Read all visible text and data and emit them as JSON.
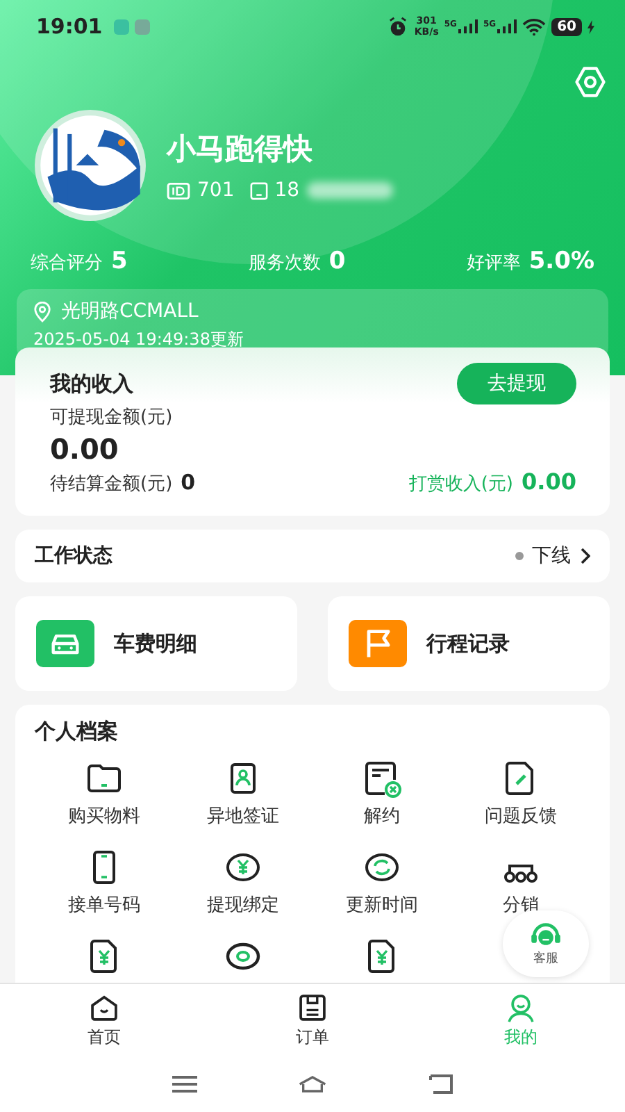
{
  "status_bar": {
    "time": "19:01",
    "speed": "301",
    "speed_unit": "KB/s",
    "network_1": "5G",
    "network_2": "5G",
    "battery": "60"
  },
  "profile": {
    "name": "小马跑得快",
    "id": "701",
    "phone": "18"
  },
  "stats": [
    {
      "label": "综合评分",
      "value": "5"
    },
    {
      "label": "服务次数",
      "value": "0"
    },
    {
      "label": "好评率",
      "value": "5.0%"
    }
  ],
  "location": {
    "place": "光明路CCMALL",
    "updated": "2025-05-04 19:49:38更新"
  },
  "income": {
    "title": "我的收入",
    "withdraw_button": "去提现",
    "available_label": "可提现金额(元)",
    "available_value": "0.00",
    "pending_label": "待结算金额(元)",
    "pending_value": "0",
    "tips_label": "打赏收入(元)",
    "tips_value": "0.00"
  },
  "work_status": {
    "label": "工作状态",
    "status": "下线",
    "online": false
  },
  "shortcuts": [
    {
      "label": "车费明细",
      "color": "#22c065"
    },
    {
      "label": "行程记录",
      "color": "#ff8a00"
    }
  ],
  "archive": {
    "title": "个人档案",
    "items": [
      {
        "kind": "labelled",
        "label": "购买物料"
      },
      {
        "kind": "labelled",
        "label": "异地签证"
      },
      {
        "kind": "labelled",
        "label": "解约"
      },
      {
        "kind": "labelled",
        "label": "问题反馈"
      },
      {
        "kind": "labelled",
        "label": "接单号码"
      },
      {
        "kind": "labelled",
        "label": "提现绑定"
      },
      {
        "kind": "labelled",
        "label": "更新时间"
      },
      {
        "kind": "labelled",
        "label": "分销"
      },
      {
        "kind": "icon_only"
      },
      {
        "kind": "icon_only"
      },
      {
        "kind": "icon_only"
      }
    ]
  },
  "service_button": "客服",
  "tabs": [
    {
      "label": "首页",
      "selected": false
    },
    {
      "label": "订单",
      "selected": false
    },
    {
      "label": "我的",
      "selected": true
    }
  ]
}
